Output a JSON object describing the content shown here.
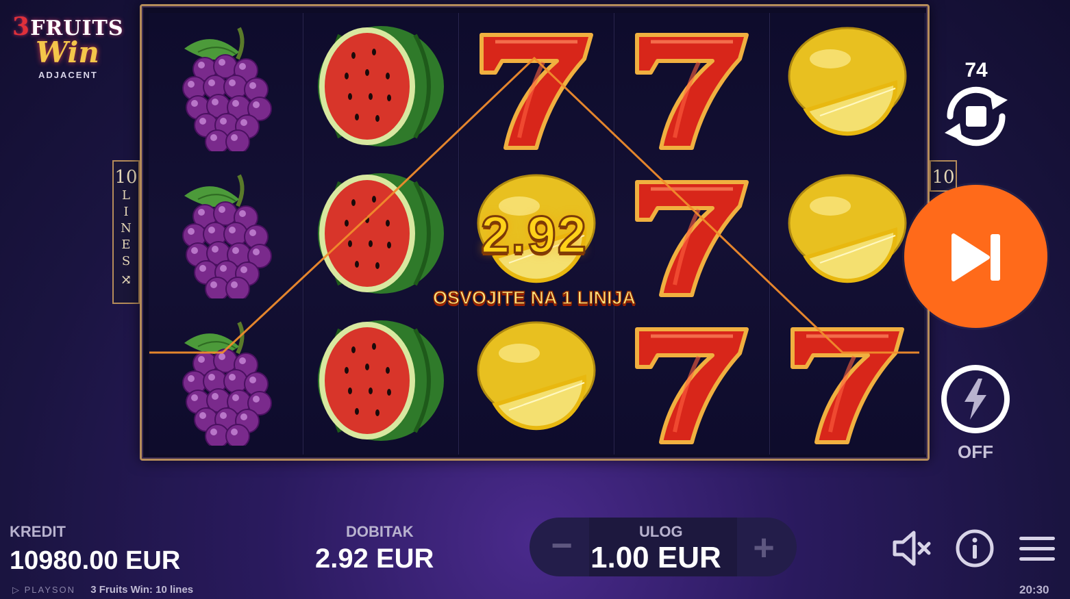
{
  "logo": {
    "line1_num": "3",
    "line1_word": "FRUITS",
    "line2": "Win",
    "line3": "ADJACENT"
  },
  "lines_badge": {
    "count": "10",
    "word": [
      "L",
      "I",
      "N",
      "E",
      "S"
    ],
    "right_count": "10"
  },
  "reels": [
    [
      "grapes",
      "grapes",
      "grapes"
    ],
    [
      "watermelon",
      "watermelon",
      "watermelon"
    ],
    [
      "seven",
      "lemon",
      "lemon"
    ],
    [
      "seven",
      "seven",
      "seven"
    ],
    [
      "lemon",
      "lemon",
      "seven"
    ]
  ],
  "win": {
    "amount": "2.92",
    "message": "OSVOJITE NA 1 LINIJA"
  },
  "autoplay": {
    "count": "74",
    "icon": "autoplay-stop-icon"
  },
  "spin": {
    "icon": "skip-forward-icon"
  },
  "turbo": {
    "icon": "lightning-icon",
    "state": "OFF"
  },
  "bottom": {
    "credit_label": "KREDIT",
    "credit_value": "10980.00 EUR",
    "win_label": "DOBITAK",
    "win_value": "2.92 EUR",
    "bet_label": "ULOG",
    "bet_value": "1.00 EUR",
    "minus": "−",
    "plus": "+"
  },
  "footer": {
    "brand": "PLAYSON",
    "game_name": "3 Fruits Win: 10 lines",
    "time": "20:30"
  },
  "colors": {
    "spin_button": "#ff6a1a",
    "win_text": "#ffd21a",
    "frame": "#b58c5a",
    "payline": "#f08c2c"
  }
}
